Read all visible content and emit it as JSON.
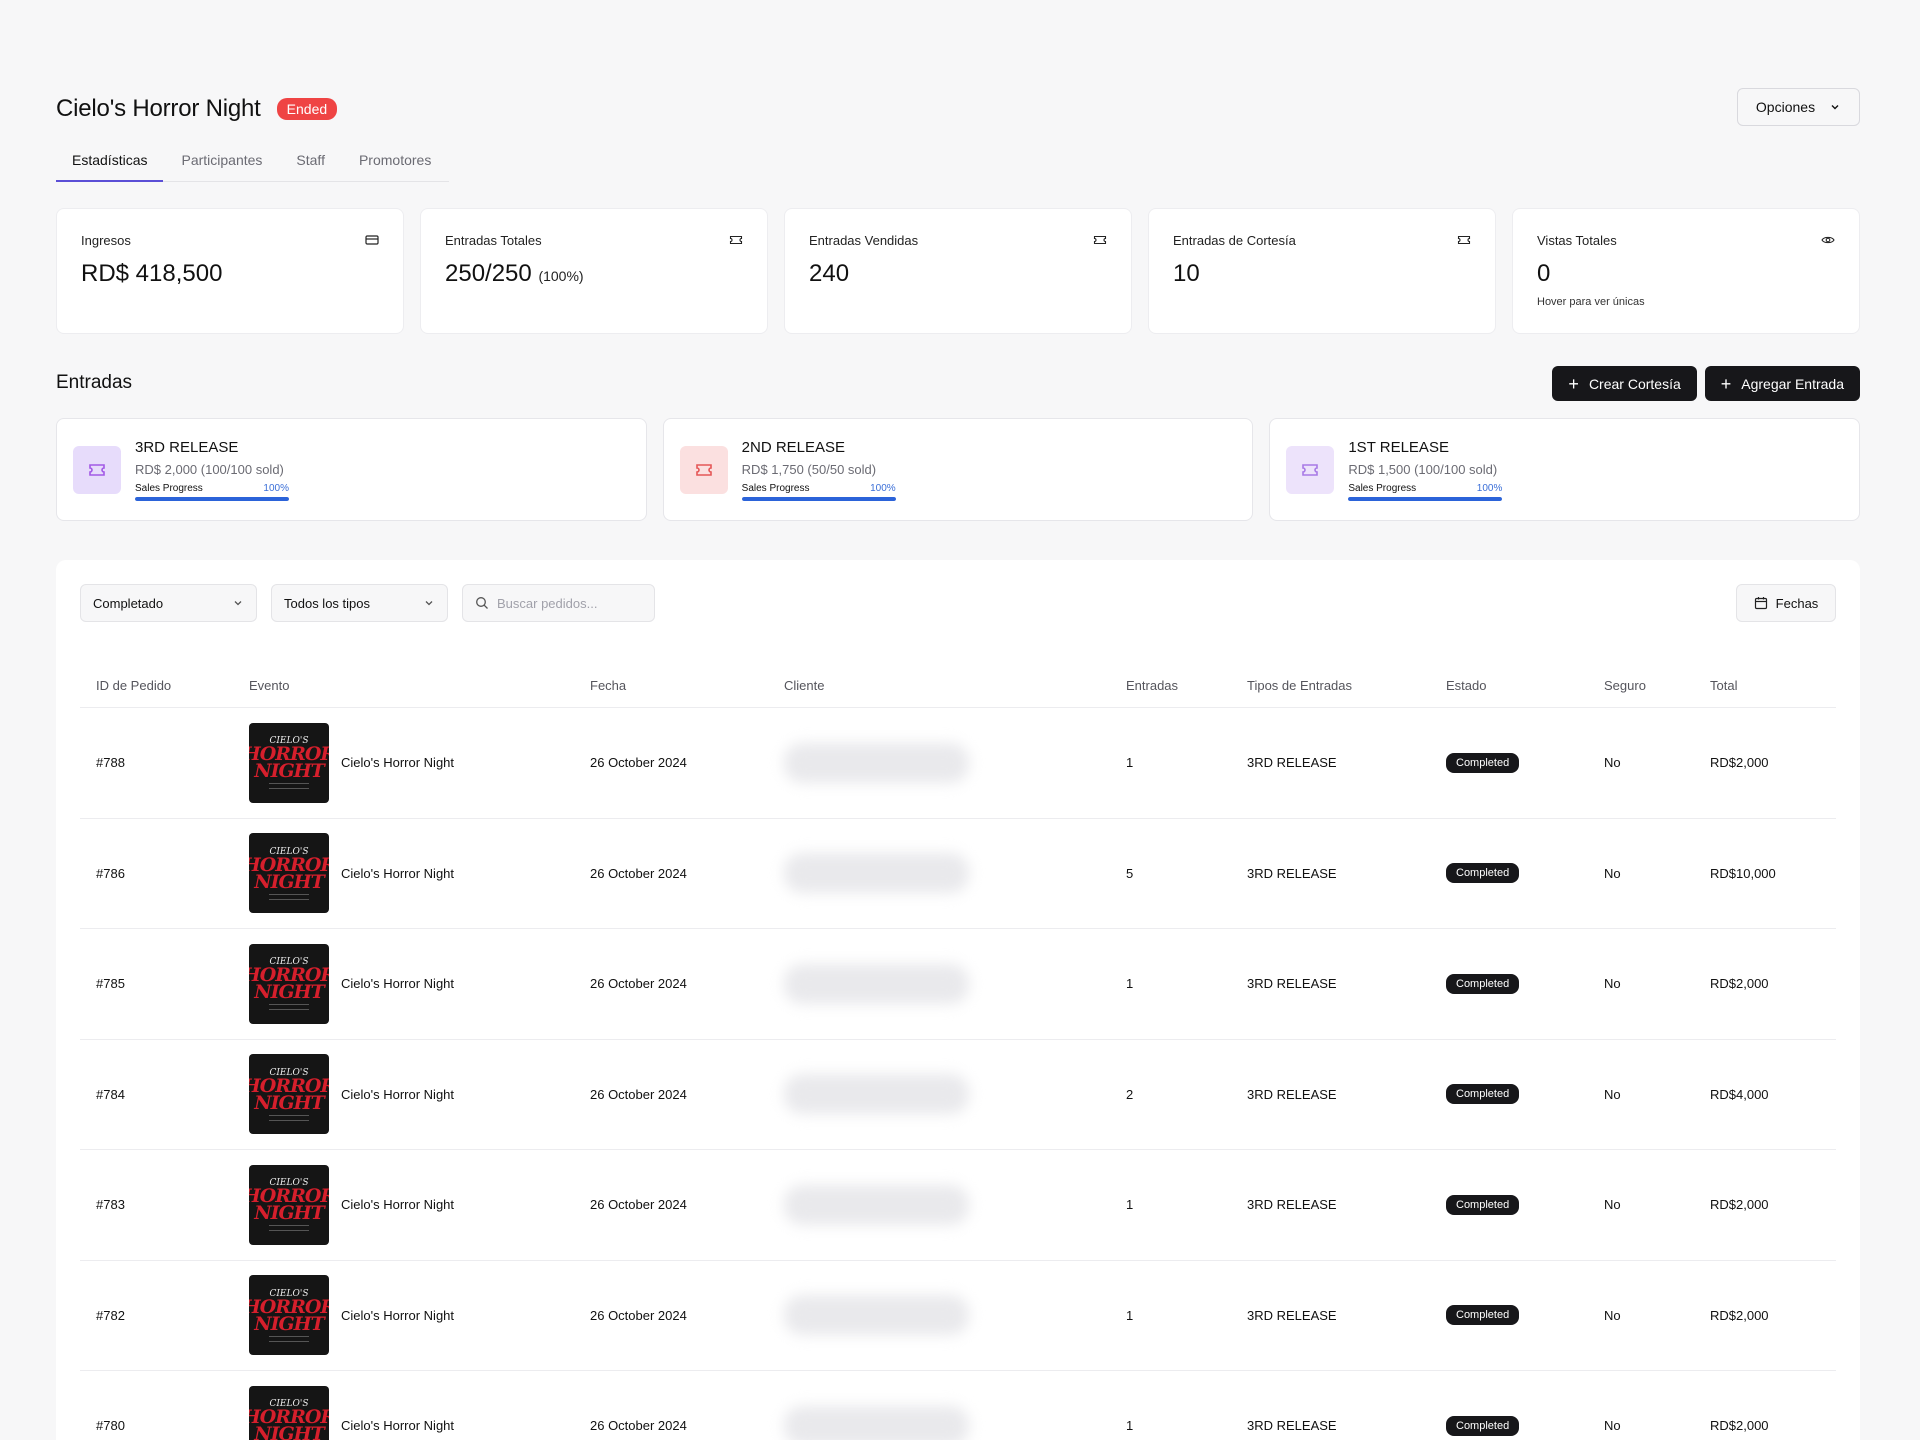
{
  "header": {
    "title": "Cielo's Horror Night",
    "badge": "Ended",
    "options_label": "Opciones"
  },
  "tabs": [
    {
      "label": "Estadísticas"
    },
    {
      "label": "Participantes"
    },
    {
      "label": "Staff"
    },
    {
      "label": "Promotores"
    }
  ],
  "stats": [
    {
      "label": "Ingresos",
      "value": "RD$ 418,500",
      "extra": "",
      "sub": "",
      "icon": "credit-card-icon"
    },
    {
      "label": "Entradas Totales",
      "value": "250/250",
      "extra": "(100%)",
      "sub": "",
      "icon": "ticket-icon"
    },
    {
      "label": "Entradas Vendidas",
      "value": "240",
      "extra": "",
      "sub": "",
      "icon": "ticket-icon"
    },
    {
      "label": "Entradas de Cortesía",
      "value": "10",
      "extra": "",
      "sub": "",
      "icon": "ticket-icon"
    },
    {
      "label": "Vistas Totales",
      "value": "0",
      "extra": "",
      "sub": "Hover para ver únicas",
      "icon": "eye-icon"
    }
  ],
  "entradas": {
    "title": "Entradas",
    "create_courtesy_label": "Crear Cortesía",
    "add_ticket_label": "Agregar Entrada",
    "tickets": [
      {
        "name": "3RD RELEASE",
        "price": "RD$ 2,000 (100/100 sold)",
        "progress_label": "Sales Progress",
        "progress_text": "100%",
        "progress": 1.0,
        "color": "#e7dcfb",
        "icon_color": "#a259e6"
      },
      {
        "name": "2ND RELEASE",
        "price": "RD$ 1,750 (50/50 sold)",
        "progress_label": "Sales Progress",
        "progress_text": "100%",
        "progress": 1.0,
        "color": "#fbe0e0",
        "icon_color": "#e55757"
      },
      {
        "name": "1ST RELEASE",
        "price": "RD$ 1,500 (100/100 sold)",
        "progress_label": "Sales Progress",
        "progress_text": "100%",
        "progress": 1.0,
        "color": "#ede3fb",
        "icon_color": "#a87ae6"
      }
    ]
  },
  "filters": {
    "status": "Completado",
    "type": "Todos los tipos",
    "search_placeholder": "Buscar pedidos...",
    "dates_label": "Fechas"
  },
  "table": {
    "headers": [
      "ID de Pedido",
      "Evento",
      "Fecha",
      "Cliente",
      "Entradas",
      "Tipos de Entradas",
      "Estado",
      "Seguro",
      "Total"
    ],
    "thumb": {
      "line1": "CIELO'S",
      "line2": "HORROR NIGHT"
    },
    "rows": [
      {
        "id": "#788",
        "event": "Cielo's Horror Night",
        "date": "26 October 2024",
        "qty": "1",
        "type": "3RD RELEASE",
        "status": "Completed",
        "insurance": "No",
        "total": "RD$2,000"
      },
      {
        "id": "#786",
        "event": "Cielo's Horror Night",
        "date": "26 October 2024",
        "qty": "5",
        "type": "3RD RELEASE",
        "status": "Completed",
        "insurance": "No",
        "total": "RD$10,000"
      },
      {
        "id": "#785",
        "event": "Cielo's Horror Night",
        "date": "26 October 2024",
        "qty": "1",
        "type": "3RD RELEASE",
        "status": "Completed",
        "insurance": "No",
        "total": "RD$2,000"
      },
      {
        "id": "#784",
        "event": "Cielo's Horror Night",
        "date": "26 October 2024",
        "qty": "2",
        "type": "3RD RELEASE",
        "status": "Completed",
        "insurance": "No",
        "total": "RD$4,000"
      },
      {
        "id": "#783",
        "event": "Cielo's Horror Night",
        "date": "26 October 2024",
        "qty": "1",
        "type": "3RD RELEASE",
        "status": "Completed",
        "insurance": "No",
        "total": "RD$2,000"
      },
      {
        "id": "#782",
        "event": "Cielo's Horror Night",
        "date": "26 October 2024",
        "qty": "1",
        "type": "3RD RELEASE",
        "status": "Completed",
        "insurance": "No",
        "total": "RD$2,000"
      },
      {
        "id": "#780",
        "event": "Cielo's Horror Night",
        "date": "26 October 2024",
        "qty": "1",
        "type": "3RD RELEASE",
        "status": "Completed",
        "insurance": "No",
        "total": "RD$2,000"
      }
    ]
  }
}
